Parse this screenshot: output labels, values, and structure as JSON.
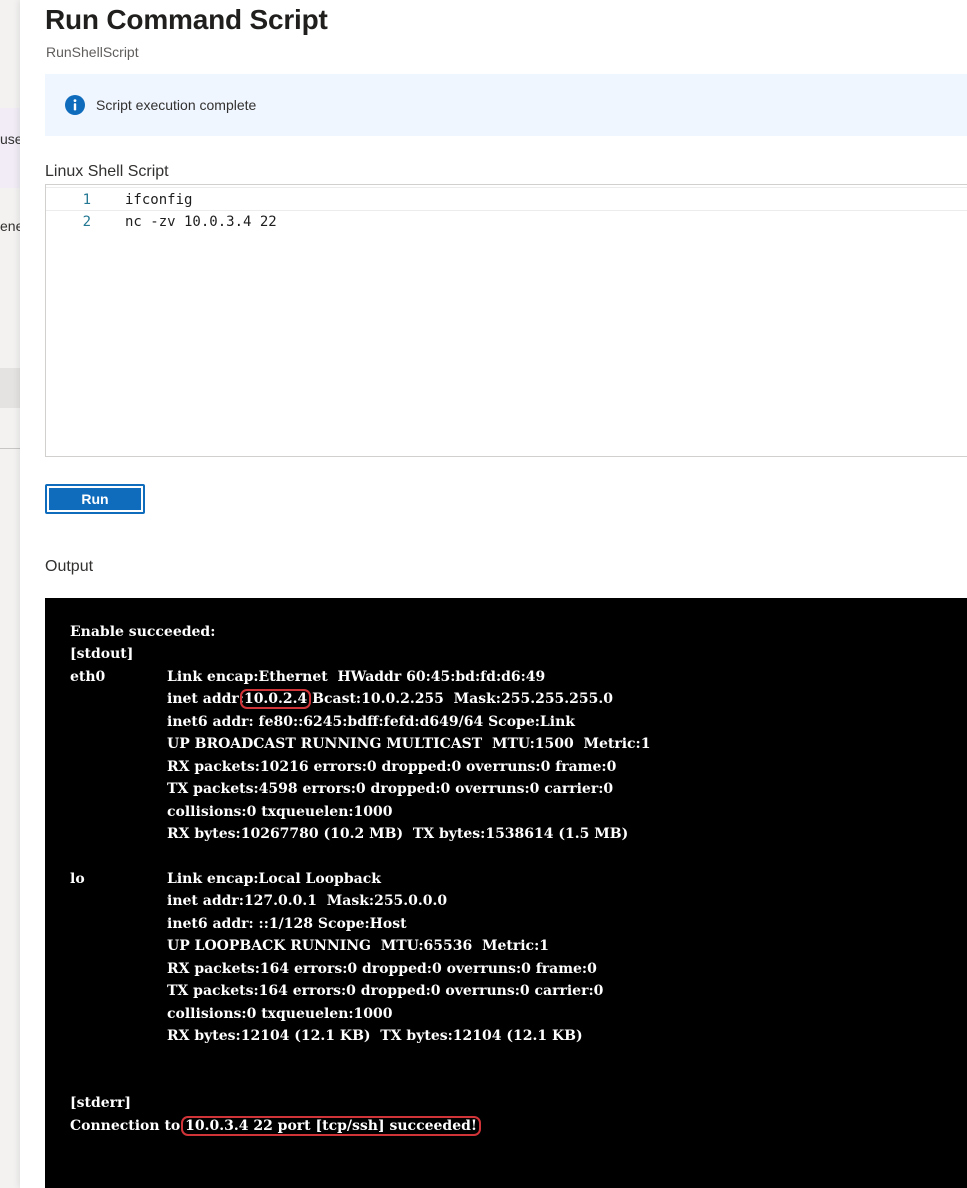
{
  "background": {
    "fragment_1": "use",
    "fragment_2": "ene"
  },
  "header": {
    "title": "Run Command Script",
    "subtitle": "RunShellScript"
  },
  "notification": {
    "icon": "info-icon",
    "message": "Script execution complete",
    "color": "#0f6cbd"
  },
  "script": {
    "label": "Linux Shell Script",
    "lines": [
      {
        "number": "1",
        "code": "ifconfig"
      },
      {
        "number": "2",
        "code": "nc -zv 10.0.3.4 22"
      }
    ]
  },
  "run_button": {
    "label": "Run"
  },
  "output": {
    "label": "Output",
    "lines": [
      {
        "c1": "Enable succeeded:",
        "c2": ""
      },
      {
        "c1": "[stdout]",
        "c2": ""
      },
      {
        "c1": "eth0",
        "c2": "Link encap:Ethernet  HWaddr 60:45:bd:fd:d6:49"
      },
      {
        "c1": "",
        "c2": "",
        "pre": "inet addr:",
        "hl": "10.0.2.4",
        "post": " Bcast:10.0.2.255  Mask:255.255.255.0"
      },
      {
        "c1": "",
        "c2": "inet6 addr: fe80::6245:bdff:fefd:d649/64 Scope:Link"
      },
      {
        "c1": "",
        "c2": "UP BROADCAST RUNNING MULTICAST  MTU:1500  Metric:1"
      },
      {
        "c1": "",
        "c2": "RX packets:10216 errors:0 dropped:0 overruns:0 frame:0"
      },
      {
        "c1": "",
        "c2": "TX packets:4598 errors:0 dropped:0 overruns:0 carrier:0"
      },
      {
        "c1": "",
        "c2": "collisions:0 txqueuelen:1000"
      },
      {
        "c1": "",
        "c2": "RX bytes:10267780 (10.2 MB)  TX bytes:1538614 (1.5 MB)"
      },
      {
        "c1": "",
        "c2": ""
      },
      {
        "c1": "lo",
        "c2": "Link encap:Local Loopback"
      },
      {
        "c1": "",
        "c2": "inet addr:127.0.0.1  Mask:255.0.0.0"
      },
      {
        "c1": "",
        "c2": "inet6 addr: ::1/128 Scope:Host"
      },
      {
        "c1": "",
        "c2": "UP LOOPBACK RUNNING  MTU:65536  Metric:1"
      },
      {
        "c1": "",
        "c2": "RX packets:164 errors:0 dropped:0 overruns:0 frame:0"
      },
      {
        "c1": "",
        "c2": "TX packets:164 errors:0 dropped:0 overruns:0 carrier:0"
      },
      {
        "c1": "",
        "c2": "collisions:0 txqueuelen:1000"
      },
      {
        "c1": "",
        "c2": "RX bytes:12104 (12.1 KB)  TX bytes:12104 (12.1 KB)"
      },
      {
        "c1": "",
        "c2": ""
      },
      {
        "c1": "",
        "c2": ""
      },
      {
        "c1": "[stderr]",
        "c2": ""
      },
      {
        "c1": "",
        "c2": "",
        "pre": "Connection to ",
        "hl": "10.0.3.4 22 port [tcp/ssh] succeeded!",
        "post": "",
        "full": true
      }
    ]
  },
  "colors": {
    "accent": "#0f6cbd",
    "info_background": "#f0f6ff",
    "console_background": "#000000",
    "highlight": "#d13438"
  }
}
